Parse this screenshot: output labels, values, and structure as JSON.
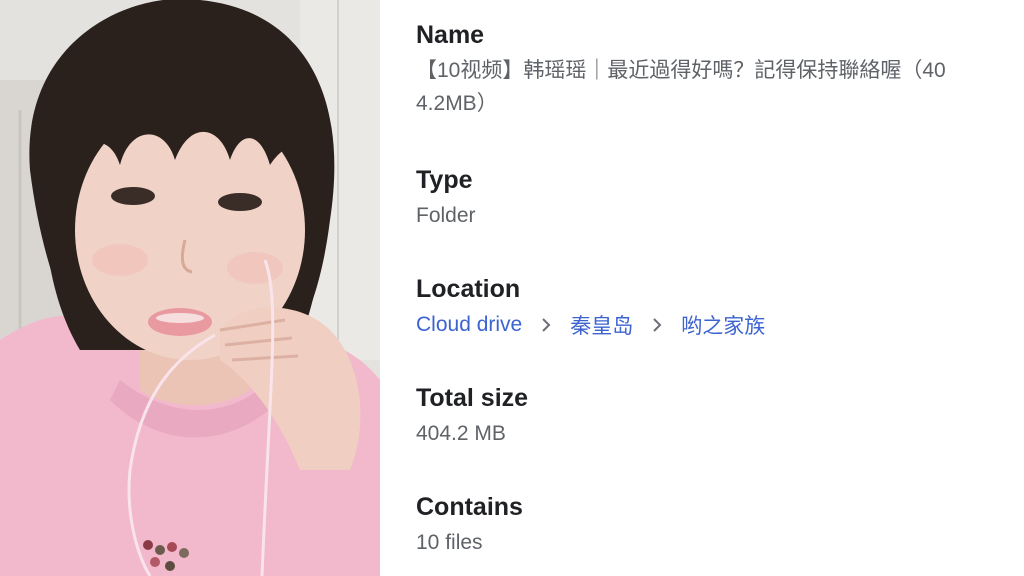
{
  "details": {
    "name": {
      "label": "Name",
      "value": "【10视频】韩瑶瑶｜最近過得好嗎？記得保持聯絡喔（404.2MB）"
    },
    "type": {
      "label": "Type",
      "value": "Folder"
    },
    "location": {
      "label": "Location",
      "crumbs": [
        "Cloud drive",
        "秦皇岛",
        "哟之家族"
      ],
      "separator_icon": "chevron-right-icon"
    },
    "total_size": {
      "label": "Total size",
      "value": "404.2 MB"
    },
    "contains": {
      "label": "Contains",
      "value": "10 files"
    }
  },
  "colors": {
    "label": "#202124",
    "value": "#5f6368",
    "link": "#3c63d0",
    "sweater": "#f2b8cc",
    "hair": "#2a211d",
    "skin": "#f1d2c6"
  }
}
